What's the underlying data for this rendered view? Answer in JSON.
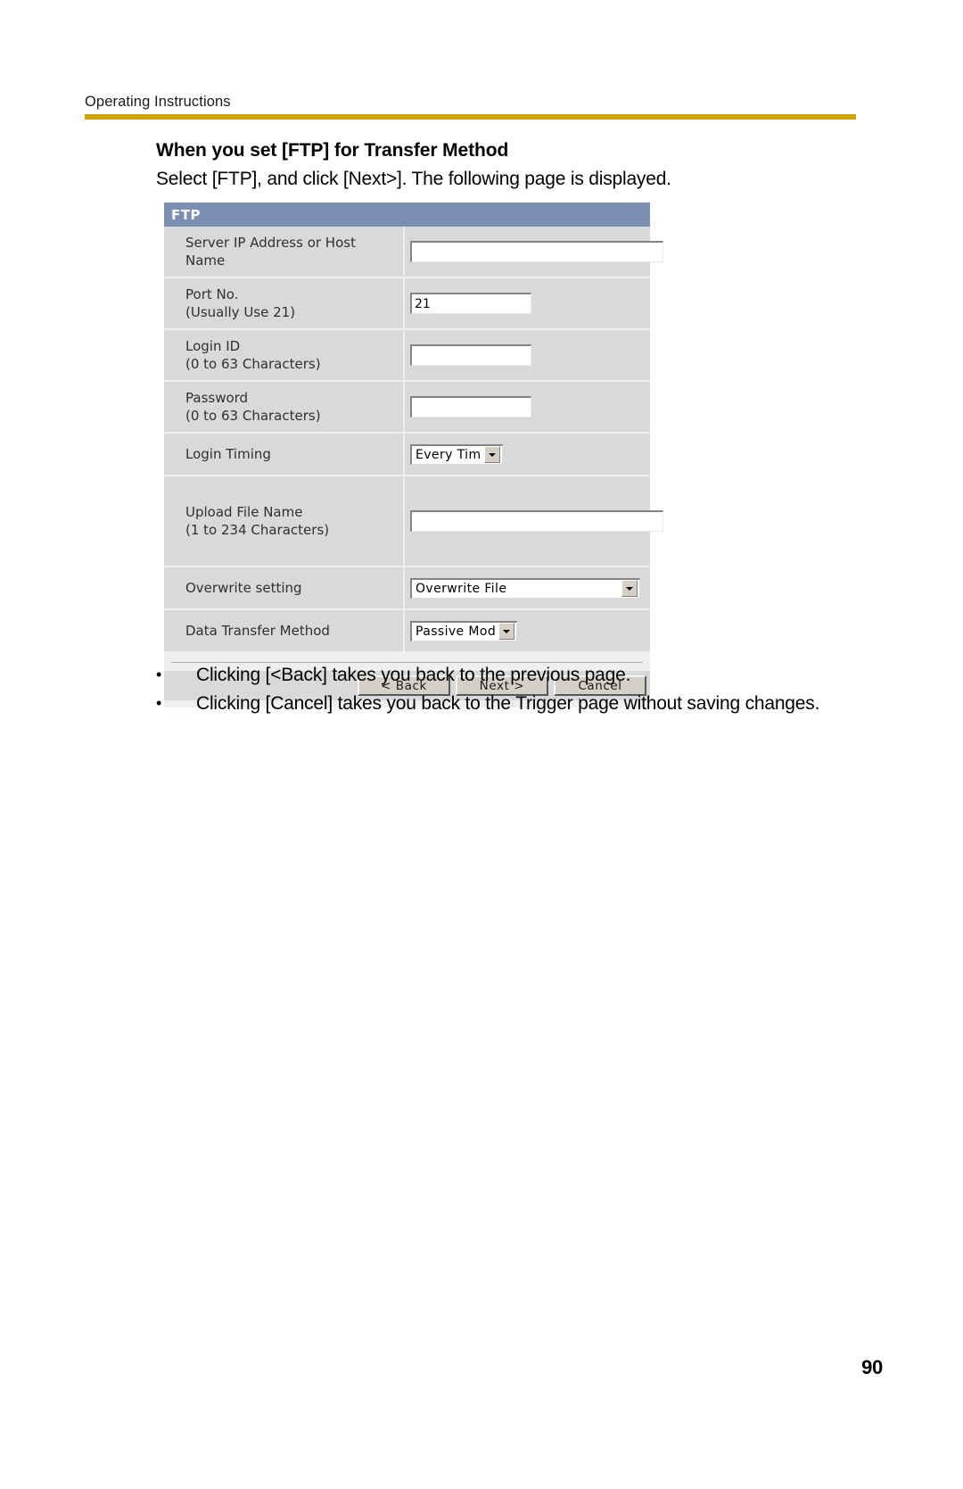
{
  "header": {
    "running_head": "Operating Instructions",
    "rule_color": "#cda400"
  },
  "section": {
    "title": "When you set [FTP] for Transfer Method",
    "lede": "Select [FTP], and click [Next>]. The following page is displayed."
  },
  "panel": {
    "title": "FTP",
    "title_bg": "#7b8fb4",
    "rows": [
      {
        "label": "Server IP Address or Host",
        "label2": "Name",
        "control": "text",
        "value": "",
        "width": "wide"
      },
      {
        "label": "Port No.",
        "label2": "(Usually Use 21)",
        "control": "text",
        "value": "21",
        "width": "mid"
      },
      {
        "label": "Login ID",
        "label2": "(0 to 63 Characters)",
        "control": "text",
        "value": "",
        "width": "mid"
      },
      {
        "label": "Password",
        "label2": "(0 to 63 Characters)",
        "control": "text",
        "value": "",
        "width": "mid"
      },
      {
        "label": "Login Timing",
        "label2": "",
        "control": "select",
        "value": "Every Time",
        "width": "sm"
      },
      {
        "label": "Upload File Name",
        "label2": "(1 to 234 Characters)",
        "control": "text",
        "value": "",
        "width": "wide"
      },
      {
        "label": "Overwrite setting",
        "label2": "",
        "control": "select",
        "value": "Overwrite File",
        "width": "lg"
      },
      {
        "label": "Data Transfer Method",
        "label2": "",
        "control": "select",
        "value": "Passive Mode",
        "width": "md"
      }
    ],
    "buttons": [
      {
        "label": "< Back"
      },
      {
        "label": "Next >"
      },
      {
        "label": "Cancel"
      }
    ]
  },
  "notes": [
    "Clicking [<Back] takes you back to the previous page.",
    "Clicking [Cancel] takes you back to the Trigger page without saving changes.",
    "•"
  ],
  "bullet_glyph": "•",
  "page_number": "90"
}
